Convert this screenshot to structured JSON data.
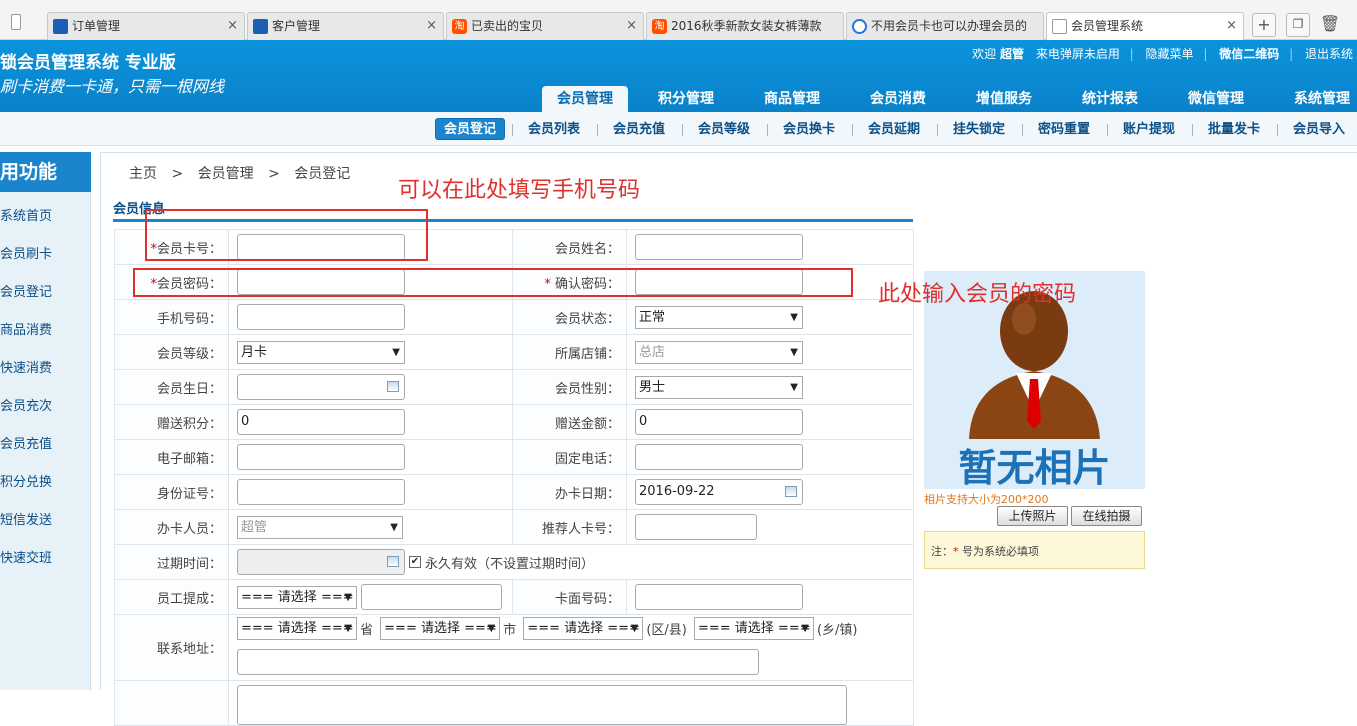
{
  "browser": {
    "tabs": [
      {
        "title": "订单管理",
        "icon": "blue"
      },
      {
        "title": "客户管理",
        "icon": "blue"
      },
      {
        "title": "已卖出的宝贝",
        "icon": "tao"
      },
      {
        "title": "2016秋季新款女装女裤薄款",
        "icon": "tao"
      },
      {
        "title": "不用会员卡也可以办理会员的",
        "icon": "ie"
      },
      {
        "title": "会员管理系统",
        "icon": "doc"
      }
    ],
    "tao_glyph": "淘",
    "close_glyph": "×",
    "new_tab": "+"
  },
  "header": {
    "brand": "锁会员管理系统 专业版",
    "slogan": "刷卡消费一卡通，只需一根网线",
    "welcome": "欢迎",
    "user": "超管",
    "links": [
      "来电弹屏未启用",
      "隐藏菜单",
      "微信二维码",
      "退出系统"
    ]
  },
  "main_nav": [
    "会员管理",
    "积分管理",
    "商品管理",
    "会员消费",
    "增值服务",
    "统计报表",
    "微信管理",
    "系统管理"
  ],
  "sub_nav": [
    "会员登记",
    "会员列表",
    "会员充值",
    "会员等级",
    "会员换卡",
    "会员延期",
    "挂失锁定",
    "密码重置",
    "账户提现",
    "批量发卡",
    "会员导入"
  ],
  "sidebar": {
    "title": "用功能",
    "items": [
      "系统首页",
      "会员刷卡",
      "会员登记",
      "商品消费",
      "快速消费",
      "会员充次",
      "会员充值",
      "积分兑换",
      "短信发送",
      "快速交班"
    ]
  },
  "breadcrumb": [
    "主页",
    ">",
    "会员管理",
    ">",
    "会员登记"
  ],
  "section_title": "会员信息",
  "form": {
    "card_no": {
      "label": "会员卡号：",
      "value": ""
    },
    "name": {
      "label": "会员姓名：",
      "value": ""
    },
    "password": {
      "label": "会员密码：",
      "value": ""
    },
    "confirm_password": {
      "label": "确认密码：",
      "value": ""
    },
    "phone": {
      "label": "手机号码：",
      "value": ""
    },
    "status": {
      "label": "会员状态：",
      "value": "正常"
    },
    "level": {
      "label": "会员等级：",
      "value": "月卡"
    },
    "store": {
      "label": "所属店铺：",
      "value": "总店"
    },
    "birthday": {
      "label": "会员生日：",
      "value": ""
    },
    "gender": {
      "label": "会员性别：",
      "value": "男士"
    },
    "gift_points": {
      "label": "赠送积分：",
      "value": "0"
    },
    "gift_amount": {
      "label": "赠送金额：",
      "value": "0"
    },
    "email": {
      "label": "电子邮箱：",
      "value": ""
    },
    "landline": {
      "label": "固定电话：",
      "value": ""
    },
    "id_no": {
      "label": "身份证号：",
      "value": ""
    },
    "open_date": {
      "label": "办卡日期：",
      "value": "2016-09-22"
    },
    "staff": {
      "label": "办卡人员：",
      "value": "超管"
    },
    "referrer": {
      "label": "推荐人卡号：",
      "value": ""
    },
    "expire": {
      "label": "过期时间：",
      "value": "",
      "checkbox_label": "永久有效（不设置过期时间）",
      "checked": true
    },
    "commission": {
      "label": "员工提成：",
      "select": "=== 请选择 ===",
      "value": ""
    },
    "card_face": {
      "label": "卡面号码：",
      "value": ""
    },
    "address": {
      "label": "联系地址：",
      "placeholder_select": "=== 请选择 ===",
      "units": [
        "省",
        "市",
        "(区/县)",
        "(乡/镇)"
      ],
      "detail": ""
    },
    "required_mark": "*"
  },
  "photo": {
    "text": "暂无相片",
    "hint": "相片支持大小为200*200",
    "upload_button": "上传照片",
    "camera_button": "在线拍摄"
  },
  "note": {
    "prefix": "注：",
    "mark": "*",
    "text": "号为系统必填项"
  },
  "annotations": {
    "phone_hint": "可以在此处填写手机号码",
    "password_hint": "此处输入会员的密码"
  },
  "colors": {
    "header": "#0b8cd6",
    "accent": "#1a84cc",
    "annotation": "#e0302d"
  }
}
